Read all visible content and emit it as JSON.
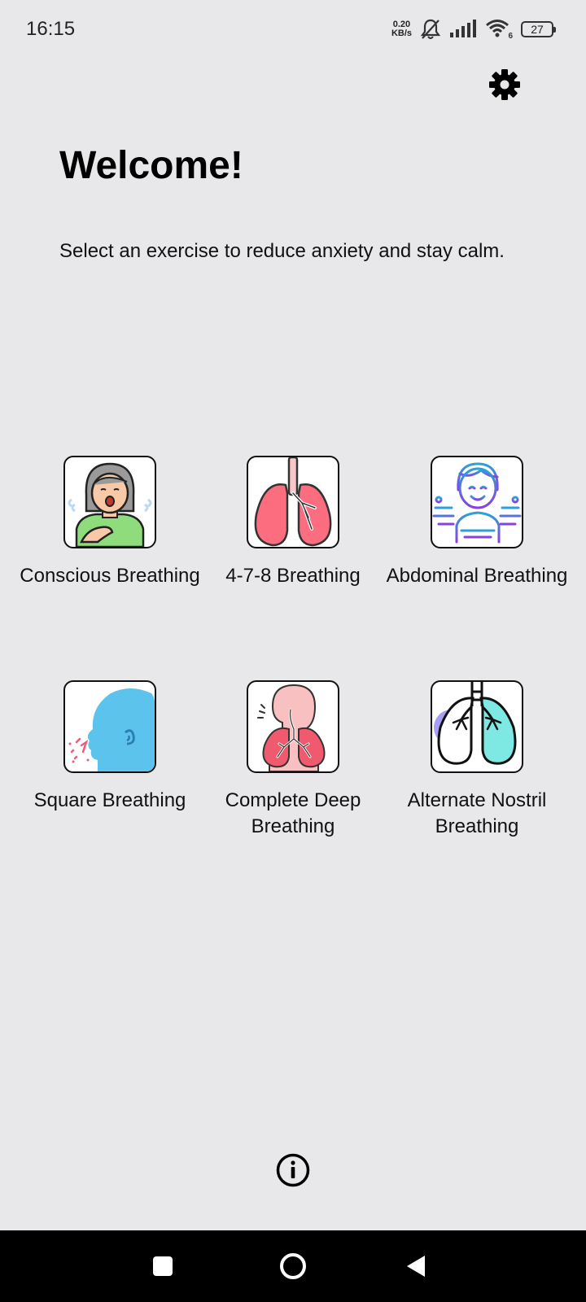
{
  "status_bar": {
    "time": "16:15",
    "net_speed_value": "0.20",
    "net_speed_unit": "KB/s",
    "wifi_badge": "6",
    "battery": "27"
  },
  "header": {
    "title": "Welcome!",
    "subtitle": "Select an exercise to reduce anxiety and stay calm."
  },
  "exercises": [
    {
      "label": "Conscious Breathing",
      "icon": "woman-exhaling-icon"
    },
    {
      "label": "4-7-8 Breathing",
      "icon": "lungs-icon"
    },
    {
      "label": "Abdominal Breathing",
      "icon": "meditating-boy-icon"
    },
    {
      "label": "Square Breathing",
      "icon": "head-profile-icon"
    },
    {
      "label": "Complete Deep Breathing",
      "icon": "respiratory-system-icon"
    },
    {
      "label": "Alternate Nostril Breathing",
      "icon": "split-lungs-icon"
    }
  ],
  "icons": {
    "settings": "gear-icon",
    "info": "info-icon",
    "nav_recents": "square-icon",
    "nav_home": "circle-icon",
    "nav_back": "triangle-back-icon"
  },
  "colors": {
    "background": "#e8e8ea",
    "nav_bar": "#000000"
  }
}
